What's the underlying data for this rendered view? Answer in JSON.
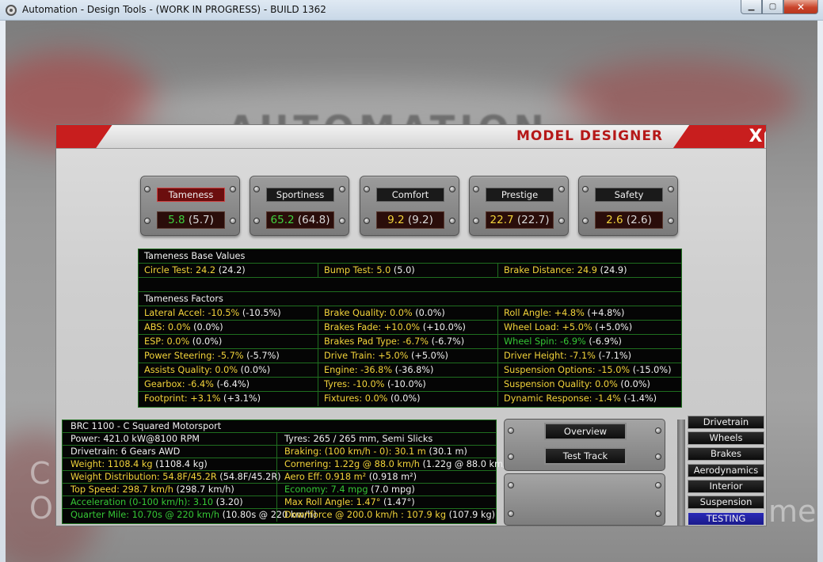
{
  "window": {
    "title": "Automation - Design Tools - (WORK IN PROGRESS) - BUILD 1362",
    "minimize_icon": "minimize-icon",
    "maximize_icon": "maximize-icon",
    "close_icon": "close-icon"
  },
  "backdrop": {
    "logo_text": "AUTOMATION",
    "ghost_left_top": "C",
    "ghost_left_bottom": "O",
    "ghost_right": "me"
  },
  "designer": {
    "title": "MODEL DESIGNER",
    "close_label": "X",
    "ratings": [
      {
        "label": "Tameness",
        "value": "5.8",
        "prev": "(5.7)",
        "value_color": "green",
        "active": true
      },
      {
        "label": "Sportiness",
        "value": "65.2",
        "prev": "(64.8)",
        "value_color": "green",
        "active": false
      },
      {
        "label": "Comfort",
        "value": "9.2",
        "prev": "(9.2)",
        "value_color": "yellow",
        "active": false
      },
      {
        "label": "Prestige",
        "value": "22.7",
        "prev": "(22.7)",
        "value_color": "yellow",
        "active": false
      },
      {
        "label": "Safety",
        "value": "2.6",
        "prev": "(2.6)",
        "value_color": "yellow",
        "active": false
      }
    ],
    "tameness": {
      "base_header": "Tameness Base Values",
      "base_values": [
        {
          "key": "Circle Test: 24.2",
          "val": " (24.2)"
        },
        {
          "key": "Bump Test: 5.0",
          "val": " (5.0)"
        },
        {
          "key": "Brake Distance: 24.9",
          "val": " (24.9)"
        }
      ],
      "factors_header": "Tameness Factors",
      "factors": [
        [
          {
            "key": "Lateral Accel: -10.5%",
            "val": " (-10.5%)",
            "c": "y"
          },
          {
            "key": "Brake Quality: 0.0%",
            "val": " (0.0%)",
            "c": "y"
          },
          {
            "key": "Roll Angle: +4.8%",
            "val": " (+4.8%)",
            "c": "y"
          }
        ],
        [
          {
            "key": "ABS: 0.0%",
            "val": " (0.0%)",
            "c": "y"
          },
          {
            "key": "Brakes Fade: +10.0%",
            "val": " (+10.0%)",
            "c": "y"
          },
          {
            "key": "Wheel Load: +5.0%",
            "val": " (+5.0%)",
            "c": "y"
          }
        ],
        [
          {
            "key": "ESP: 0.0%",
            "val": " (0.0%)",
            "c": "y"
          },
          {
            "key": "Brakes Pad Type: -6.7%",
            "val": " (-6.7%)",
            "c": "y"
          },
          {
            "key": "Wheel Spin: -6.9%",
            "val": " (-6.9%)",
            "c": "g"
          }
        ],
        [
          {
            "key": "Power Steering: -5.7%",
            "val": " (-5.7%)",
            "c": "y"
          },
          {
            "key": "Drive Train: +5.0%",
            "val": " (+5.0%)",
            "c": "y"
          },
          {
            "key": "Driver Height: -7.1%",
            "val": " (-7.1%)",
            "c": "y"
          }
        ],
        [
          {
            "key": "Assists Quality: 0.0%",
            "val": " (0.0%)",
            "c": "y"
          },
          {
            "key": "Engine: -36.8%",
            "val": " (-36.8%)",
            "c": "y"
          },
          {
            "key": "Suspension Options: -15.0%",
            "val": " (-15.0%)",
            "c": "y"
          }
        ],
        [
          {
            "key": "Gearbox: -6.4%",
            "val": " (-6.4%)",
            "c": "y"
          },
          {
            "key": "Tyres: -10.0%",
            "val": " (-10.0%)",
            "c": "y"
          },
          {
            "key": "Suspension Quality: 0.0%",
            "val": " (0.0%)",
            "c": "y"
          }
        ],
        [
          {
            "key": "Footprint: +3.1%",
            "val": " (+3.1%)",
            "c": "y"
          },
          {
            "key": "Fixtures: 0.0%",
            "val": " (0.0%)",
            "c": "y"
          },
          {
            "key": "Dynamic Response: -1.4%",
            "val": " (-1.4%)",
            "c": "y"
          }
        ]
      ]
    },
    "car": {
      "name": "BRC 1100 - C Squared Motorsport",
      "rows": [
        [
          {
            "key": "Power: 421.0 kW@8100 RPM",
            "val": "",
            "c": "w"
          },
          {
            "key": "Tyres: 265 / 265 mm, Semi Slicks",
            "val": "",
            "c": "w"
          }
        ],
        [
          {
            "key": "Drivetrain: 6 Gears AWD",
            "val": "",
            "c": "w"
          },
          {
            "key": "Braking: (100 km/h - 0): 30.1 m",
            "val": " (30.1 m)",
            "c": "y"
          }
        ],
        [
          {
            "key": "Weight: 1108.4 kg",
            "val": " (1108.4 kg)",
            "c": "y"
          },
          {
            "key": "Cornering: 1.22g @ 88.0 km/h",
            "val": " (1.22g @ 88.0 km/h)",
            "c": "y"
          }
        ],
        [
          {
            "key": "Weight Distribution: 54.8F/45.2R",
            "val": " (54.8F/45.2R)",
            "c": "y"
          },
          {
            "key": "Aero Eff: 0.918 m²",
            "val": " (0.918 m²)",
            "c": "y"
          }
        ],
        [
          {
            "key": "Top Speed: 298.7 km/h",
            "val": " (298.7 km/h)",
            "c": "y"
          },
          {
            "key": "Economy: 7.4 mpg",
            "val": " (7.0 mpg)",
            "c": "g"
          }
        ],
        [
          {
            "key": "Acceleration (0-100 km/h): 3.10",
            "val": " (3.20)",
            "c": "g"
          },
          {
            "key": "Max Roll Angle: 1.47°",
            "val": " (1.47°)",
            "c": "y"
          }
        ],
        [
          {
            "key": "Quarter Mile: 10.70s @ 220 km/h",
            "val": " (10.80s @ 220 km/h)",
            "c": "g"
          },
          {
            "key": "Downforce @ 200.0 km/h : 107.9 kg",
            "val": " (107.9 kg)",
            "c": "y"
          }
        ]
      ]
    },
    "buttons": {
      "overview": "Overview",
      "test_track": "Test Track"
    },
    "tabs": [
      {
        "label": "Drivetrain",
        "active": false
      },
      {
        "label": "Wheels",
        "active": false
      },
      {
        "label": "Brakes",
        "active": false
      },
      {
        "label": "Aerodynamics",
        "active": false
      },
      {
        "label": "Interior",
        "active": false
      },
      {
        "label": "Suspension",
        "active": false
      },
      {
        "label": "TESTING",
        "active": true
      }
    ]
  }
}
